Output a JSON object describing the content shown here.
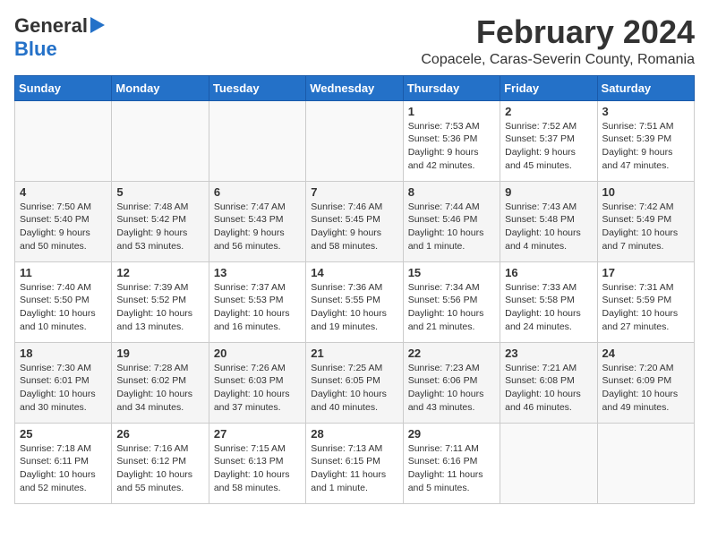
{
  "header": {
    "logo_line1": "General",
    "logo_line2": "Blue",
    "month": "February 2024",
    "location": "Copacele, Caras-Severin County, Romania"
  },
  "weekdays": [
    "Sunday",
    "Monday",
    "Tuesday",
    "Wednesday",
    "Thursday",
    "Friday",
    "Saturday"
  ],
  "weeks": [
    [
      {
        "day": "",
        "info": ""
      },
      {
        "day": "",
        "info": ""
      },
      {
        "day": "",
        "info": ""
      },
      {
        "day": "",
        "info": ""
      },
      {
        "day": "1",
        "info": "Sunrise: 7:53 AM\nSunset: 5:36 PM\nDaylight: 9 hours\nand 42 minutes."
      },
      {
        "day": "2",
        "info": "Sunrise: 7:52 AM\nSunset: 5:37 PM\nDaylight: 9 hours\nand 45 minutes."
      },
      {
        "day": "3",
        "info": "Sunrise: 7:51 AM\nSunset: 5:39 PM\nDaylight: 9 hours\nand 47 minutes."
      }
    ],
    [
      {
        "day": "4",
        "info": "Sunrise: 7:50 AM\nSunset: 5:40 PM\nDaylight: 9 hours\nand 50 minutes."
      },
      {
        "day": "5",
        "info": "Sunrise: 7:48 AM\nSunset: 5:42 PM\nDaylight: 9 hours\nand 53 minutes."
      },
      {
        "day": "6",
        "info": "Sunrise: 7:47 AM\nSunset: 5:43 PM\nDaylight: 9 hours\nand 56 minutes."
      },
      {
        "day": "7",
        "info": "Sunrise: 7:46 AM\nSunset: 5:45 PM\nDaylight: 9 hours\nand 58 minutes."
      },
      {
        "day": "8",
        "info": "Sunrise: 7:44 AM\nSunset: 5:46 PM\nDaylight: 10 hours\nand 1 minute."
      },
      {
        "day": "9",
        "info": "Sunrise: 7:43 AM\nSunset: 5:48 PM\nDaylight: 10 hours\nand 4 minutes."
      },
      {
        "day": "10",
        "info": "Sunrise: 7:42 AM\nSunset: 5:49 PM\nDaylight: 10 hours\nand 7 minutes."
      }
    ],
    [
      {
        "day": "11",
        "info": "Sunrise: 7:40 AM\nSunset: 5:50 PM\nDaylight: 10 hours\nand 10 minutes."
      },
      {
        "day": "12",
        "info": "Sunrise: 7:39 AM\nSunset: 5:52 PM\nDaylight: 10 hours\nand 13 minutes."
      },
      {
        "day": "13",
        "info": "Sunrise: 7:37 AM\nSunset: 5:53 PM\nDaylight: 10 hours\nand 16 minutes."
      },
      {
        "day": "14",
        "info": "Sunrise: 7:36 AM\nSunset: 5:55 PM\nDaylight: 10 hours\nand 19 minutes."
      },
      {
        "day": "15",
        "info": "Sunrise: 7:34 AM\nSunset: 5:56 PM\nDaylight: 10 hours\nand 21 minutes."
      },
      {
        "day": "16",
        "info": "Sunrise: 7:33 AM\nSunset: 5:58 PM\nDaylight: 10 hours\nand 24 minutes."
      },
      {
        "day": "17",
        "info": "Sunrise: 7:31 AM\nSunset: 5:59 PM\nDaylight: 10 hours\nand 27 minutes."
      }
    ],
    [
      {
        "day": "18",
        "info": "Sunrise: 7:30 AM\nSunset: 6:01 PM\nDaylight: 10 hours\nand 30 minutes."
      },
      {
        "day": "19",
        "info": "Sunrise: 7:28 AM\nSunset: 6:02 PM\nDaylight: 10 hours\nand 34 minutes."
      },
      {
        "day": "20",
        "info": "Sunrise: 7:26 AM\nSunset: 6:03 PM\nDaylight: 10 hours\nand 37 minutes."
      },
      {
        "day": "21",
        "info": "Sunrise: 7:25 AM\nSunset: 6:05 PM\nDaylight: 10 hours\nand 40 minutes."
      },
      {
        "day": "22",
        "info": "Sunrise: 7:23 AM\nSunset: 6:06 PM\nDaylight: 10 hours\nand 43 minutes."
      },
      {
        "day": "23",
        "info": "Sunrise: 7:21 AM\nSunset: 6:08 PM\nDaylight: 10 hours\nand 46 minutes."
      },
      {
        "day": "24",
        "info": "Sunrise: 7:20 AM\nSunset: 6:09 PM\nDaylight: 10 hours\nand 49 minutes."
      }
    ],
    [
      {
        "day": "25",
        "info": "Sunrise: 7:18 AM\nSunset: 6:11 PM\nDaylight: 10 hours\nand 52 minutes."
      },
      {
        "day": "26",
        "info": "Sunrise: 7:16 AM\nSunset: 6:12 PM\nDaylight: 10 hours\nand 55 minutes."
      },
      {
        "day": "27",
        "info": "Sunrise: 7:15 AM\nSunset: 6:13 PM\nDaylight: 10 hours\nand 58 minutes."
      },
      {
        "day": "28",
        "info": "Sunrise: 7:13 AM\nSunset: 6:15 PM\nDaylight: 11 hours\nand 1 minute."
      },
      {
        "day": "29",
        "info": "Sunrise: 7:11 AM\nSunset: 6:16 PM\nDaylight: 11 hours\nand 5 minutes."
      },
      {
        "day": "",
        "info": ""
      },
      {
        "day": "",
        "info": ""
      }
    ]
  ]
}
